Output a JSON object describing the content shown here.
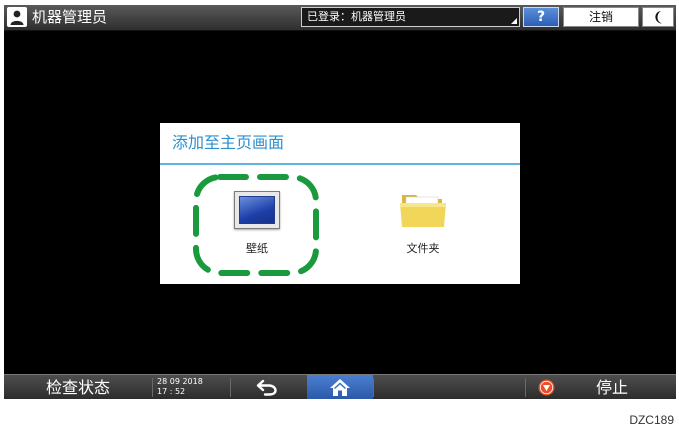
{
  "topbar": {
    "user_title": "机器管理员",
    "logged_in_text": "已登录：机器管理员",
    "help_label": "?",
    "logout_label": "注销"
  },
  "dialog": {
    "title": "添加至主页画面",
    "items": [
      {
        "label": "壁纸",
        "icon": "wallpaper-icon",
        "highlighted": true
      },
      {
        "label": "文件夹",
        "icon": "folder-icon",
        "highlighted": false
      }
    ]
  },
  "bottombar": {
    "check_status_label": "检查状态",
    "date": "28 09 2018",
    "time": "17 : 52",
    "stop_label": "停止"
  },
  "figure_code": "DZC189",
  "colors": {
    "dialog_title": "#2c8fcf",
    "highlight_ring": "#1a9a3c",
    "home_button": "#3a6cc0",
    "stop_icon": "#e8502a"
  }
}
